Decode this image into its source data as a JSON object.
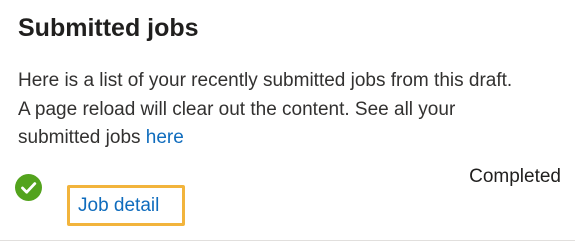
{
  "panel": {
    "title": "Submitted jobs",
    "description_lines": [
      "Here is a list of your recently submitted jobs from this draft.",
      "A page reload will clear out the content. See all your"
    ],
    "description_last_prefix": "submitted jobs ",
    "here_link": "here"
  },
  "jobs": [
    {
      "status": "Completed",
      "status_icon": "check-circle-icon",
      "detail_link": "Job detail"
    }
  ],
  "colors": {
    "link": "#0f6cbd",
    "success": "#53a31d",
    "focus_outline": "#f2b43c"
  }
}
